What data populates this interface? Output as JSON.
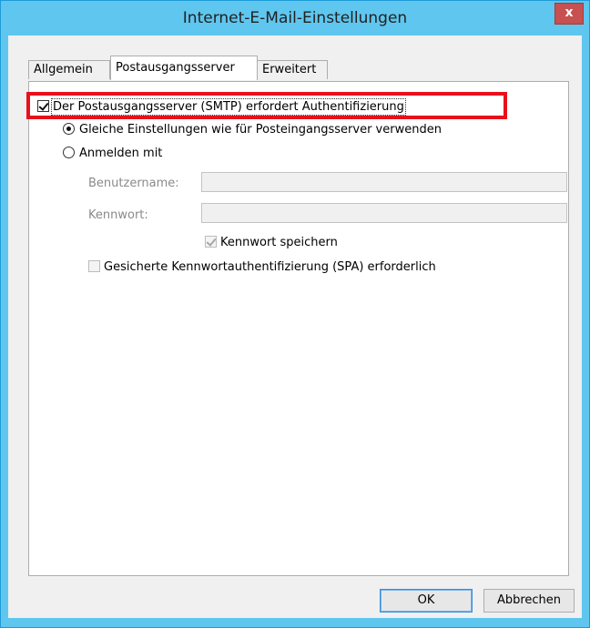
{
  "window": {
    "title": "Internet-E-Mail-Einstellungen",
    "close_label": "x"
  },
  "tabs": [
    {
      "label": "Allgemein",
      "active": false
    },
    {
      "label": "Postausgangsserver",
      "active": true
    },
    {
      "label": "Erweitert",
      "active": false
    }
  ],
  "smtp_auth": {
    "label": "Der Postausgangsserver (SMTP) erfordert Authentifizierung",
    "checked": true
  },
  "radio_same": {
    "label": "Gleiche Einstellungen wie für Posteingangsserver verwenden",
    "selected": true
  },
  "radio_login": {
    "label": "Anmelden mit",
    "selected": false
  },
  "username": {
    "label": "Benutzername:",
    "value": ""
  },
  "password": {
    "label": "Kennwort:",
    "value": ""
  },
  "save_password": {
    "label": "Kennwort speichern",
    "checked": true
  },
  "spa": {
    "label": "Gesicherte Kennwortauthentifizierung (SPA) erforderlich",
    "checked": false
  },
  "buttons": {
    "ok": "OK",
    "cancel": "Abbrechen"
  },
  "colors": {
    "titlebar": "#5fc6ef",
    "highlight": "#e8101b"
  }
}
